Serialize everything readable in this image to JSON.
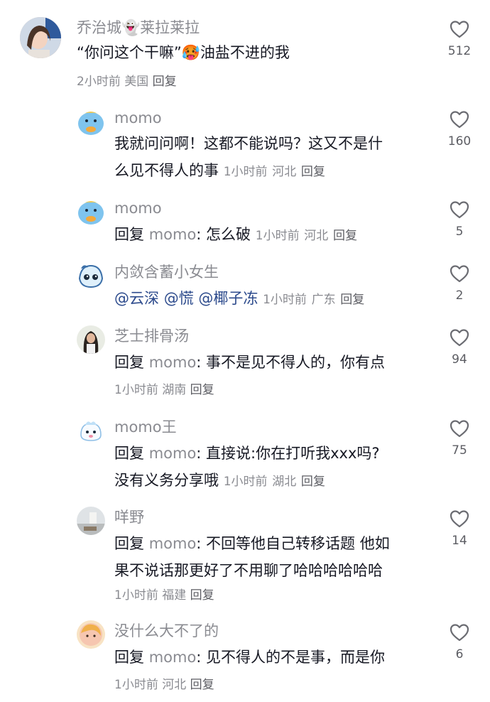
{
  "comments": [
    {
      "name": "乔治城👻莱拉莱拉",
      "text": "“你问这个干嘛”🥵油盐不进的我",
      "meta_time": "2小时前",
      "meta_loc": "美国",
      "reply_btn": "回复",
      "likes": "512"
    },
    {
      "name": "momo",
      "line1": "我就问问啊！这都不能说吗？这又不是什",
      "line2": "么见不得人的事",
      "meta_time": "1小时前",
      "meta_loc": "河北",
      "reply_btn": "回复",
      "likes": "160"
    },
    {
      "name": "momo",
      "reply_prefix": "回复",
      "reply_target": "momo",
      "text": ": 怎么破",
      "meta_time": "1小时前",
      "meta_loc": "河北",
      "reply_btn": "回复",
      "likes": "5"
    },
    {
      "name": "内敛含蓄小女生",
      "mentions": [
        "@云深",
        "@慌",
        "@椰子冻"
      ],
      "meta_time": "1小时前",
      "meta_loc": "广东",
      "reply_btn": "回复",
      "likes": "2"
    },
    {
      "name": "芝士排骨汤",
      "reply_prefix": "回复",
      "reply_target": "momo",
      "text": ": 事不是见不得人的，你有点",
      "meta_time": "1小时前",
      "meta_loc": "湖南",
      "reply_btn": "回复",
      "likes": "94"
    },
    {
      "name": "momo王",
      "reply_prefix": "回复",
      "reply_target": "momo",
      "text": ": 直接说:你在打听我xxx吗?",
      "line2": "没有义务分享哦",
      "meta_time": "1小时前",
      "meta_loc": "湖北",
      "reply_btn": "回复",
      "likes": "75"
    },
    {
      "name": "咩野",
      "reply_prefix": "回复",
      "reply_target": "momo",
      "text": ": 不回等他自己转移话题  他如",
      "line2": "果不说话那更好了不用聊了哈哈哈哈哈哈",
      "meta_time": "1小时前",
      "meta_loc": "福建",
      "reply_btn": "回复",
      "likes": "14"
    },
    {
      "name": "没什么大不了的",
      "reply_prefix": "回复",
      "reply_target": "momo",
      "text": ": 见不得人的不是事，而是你",
      "meta_time": "1小时前",
      "meta_loc": "河北",
      "reply_btn": "回复",
      "likes": "6"
    }
  ],
  "icons": {
    "like": "heart-outline-icon"
  }
}
